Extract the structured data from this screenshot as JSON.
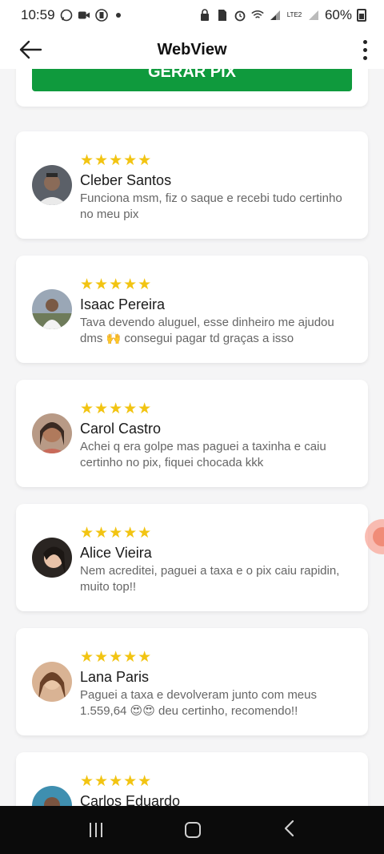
{
  "status_bar": {
    "time": "10:59",
    "battery": "60%",
    "network": "LTE2"
  },
  "app_bar": {
    "title": "WebView"
  },
  "top_button": {
    "label": "GERAR PIX",
    "color": "#0f9a3d"
  },
  "reviews": [
    {
      "stars": "★★★★★",
      "name": "Cleber Santos",
      "text": "Funciona msm, fiz o saque e recebi tudo certinho no meu pix"
    },
    {
      "stars": "★★★★★",
      "name": "Isaac Pereira",
      "text": "Tava devendo aluguel, esse dinheiro me ajudou dms 🙌 consegui pagar td graças a isso"
    },
    {
      "stars": "★★★★★",
      "name": "Carol Castro",
      "text": "Achei q era golpe mas paguei a taxinha e caiu certinho no pix, fiquei chocada kkk"
    },
    {
      "stars": "★★★★★",
      "name": "Alice Vieira",
      "text": "Nem acreditei, paguei a taxa e o pix caiu rapidin, muito top!!"
    },
    {
      "stars": "★★★★★",
      "name": "Lana Paris",
      "text": "Paguei a taxa e devolveram junto com meus 1.559,64 😍😍 deu certinho, recomendo!!"
    },
    {
      "stars": "★★★★★",
      "name": "Carlos Eduardo",
      "text": ""
    }
  ],
  "colors": {
    "star": "#f2c412",
    "background": "#f5f5f6"
  }
}
